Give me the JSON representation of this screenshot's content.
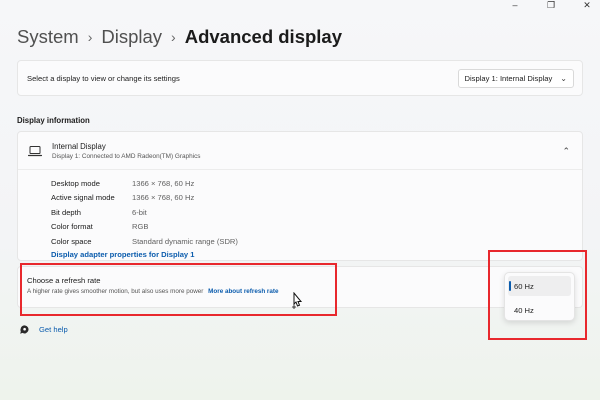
{
  "window_controls": [
    "–",
    "❐",
    "✕"
  ],
  "breadcrumb": {
    "items": [
      "System",
      "Display"
    ],
    "current": "Advanced display",
    "separator": "›"
  },
  "display_select": {
    "label": "Select a display to view or change its settings",
    "value": "Display 1: Internal Display"
  },
  "display_information": {
    "section_title": "Display information",
    "display_name": "Internal Display",
    "display_subtitle": "Display 1: Connected to AMD Radeon(TM) Graphics",
    "properties": [
      {
        "key": "Desktop mode",
        "value": "1366 × 768, 60 Hz"
      },
      {
        "key": "Active signal mode",
        "value": "1366 × 768, 60 Hz"
      },
      {
        "key": "Bit depth",
        "value": "6-bit"
      },
      {
        "key": "Color format",
        "value": "RGB"
      },
      {
        "key": "Color space",
        "value": "Standard dynamic range (SDR)"
      }
    ],
    "adapter_link": "Display adapter properties for Display 1"
  },
  "refresh_rate": {
    "title": "Choose a refresh rate",
    "description": "A higher rate gives smoother motion, but also uses more power",
    "more_link": "More about refresh rate",
    "options": [
      {
        "label": "60 Hz",
        "selected": true
      },
      {
        "label": "40 Hz",
        "selected": false
      }
    ]
  },
  "help": {
    "label": "Get help"
  },
  "colors": {
    "accent": "#0b5cad",
    "highlight": "#e8282d"
  }
}
